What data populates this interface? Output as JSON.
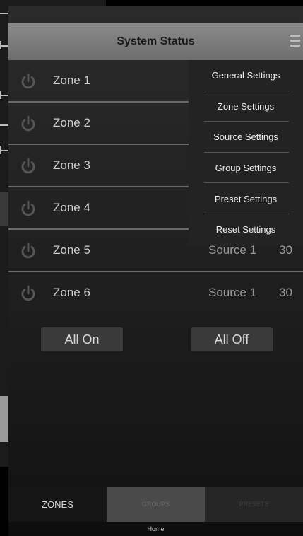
{
  "header": {
    "title": "System Status",
    "menu_icon": "hamburger-icon"
  },
  "zones": [
    {
      "name": "Zone 1",
      "source": "",
      "volume": ""
    },
    {
      "name": "Zone 2",
      "source": "",
      "volume": ""
    },
    {
      "name": "Zone 3",
      "source": "",
      "volume": ""
    },
    {
      "name": "Zone 4",
      "source": "",
      "volume": ""
    },
    {
      "name": "Zone 5",
      "source": "Source 1",
      "volume": "30"
    },
    {
      "name": "Zone 6",
      "source": "Source 1",
      "volume": "30"
    }
  ],
  "actions": {
    "all_on": "All On",
    "all_off": "All Off"
  },
  "menu": {
    "items": [
      "General Settings",
      "Zone Settings",
      "Source Settings",
      "Group Settings",
      "Preset Settings",
      "Reset Settings"
    ]
  },
  "tabs": {
    "zones": "ZONES",
    "groups": "GROUPS",
    "presets": "PRESETS"
  },
  "footer": {
    "home": "Home"
  },
  "colors": {
    "power_icon": "#555555",
    "title_bar": "#7a7a7a",
    "menu_bg": "#232323"
  }
}
